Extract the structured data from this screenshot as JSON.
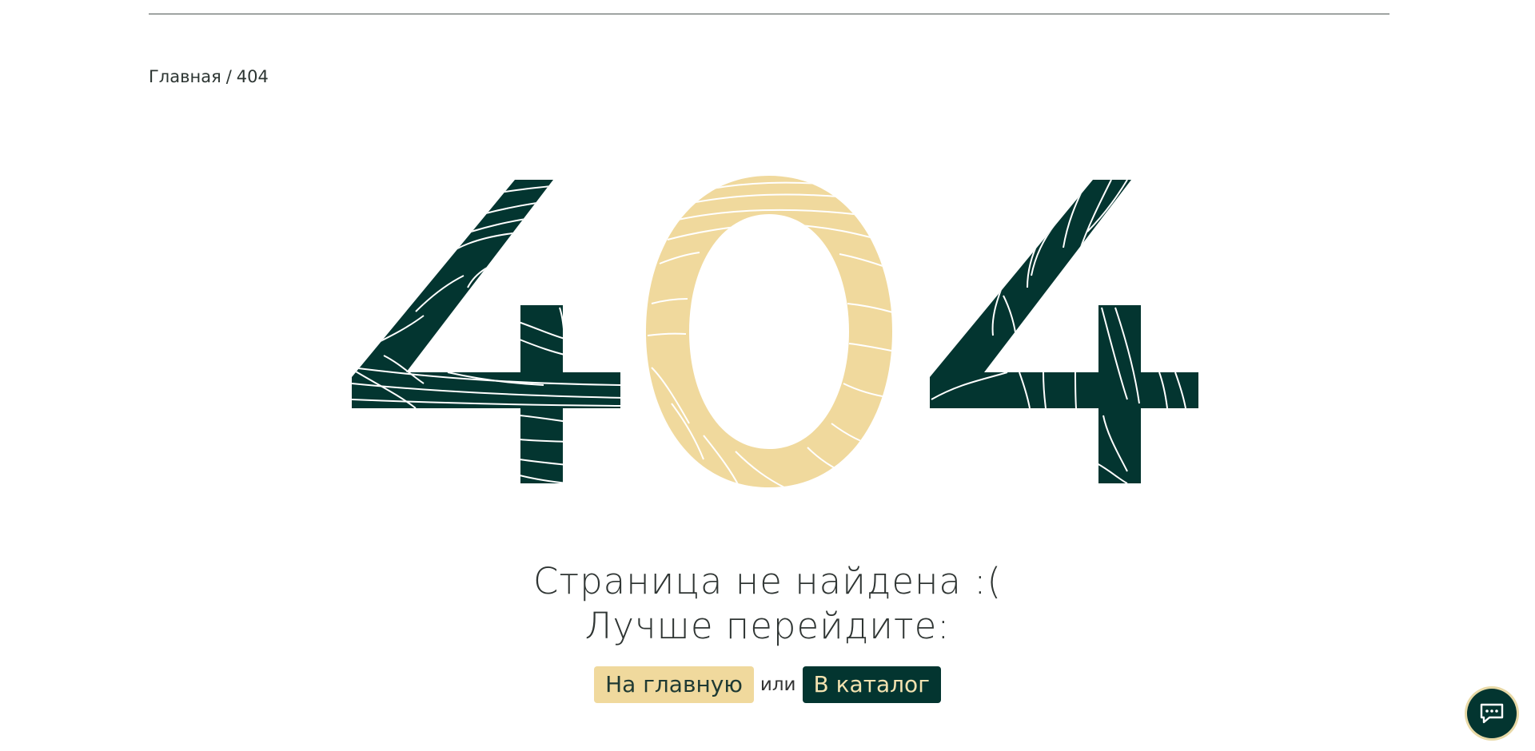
{
  "breadcrumb": {
    "home": "Главная",
    "separator": "/",
    "current": "404"
  },
  "hero": {
    "code": "404",
    "left_digit_color": "#033530",
    "middle_digit_color": "#f0d99d",
    "right_digit_color": "#033530"
  },
  "message": {
    "line1": "Страница не найдена :(",
    "line2": "Лучше перейдите:"
  },
  "actions": {
    "home_label": "На главную",
    "or_label": "или",
    "catalog_label": "В каталог"
  },
  "chat": {
    "icon": "chat-bubble-icon"
  },
  "colors": {
    "dark_green": "#033530",
    "sand": "#f0d99d",
    "text": "#2f3533"
  }
}
